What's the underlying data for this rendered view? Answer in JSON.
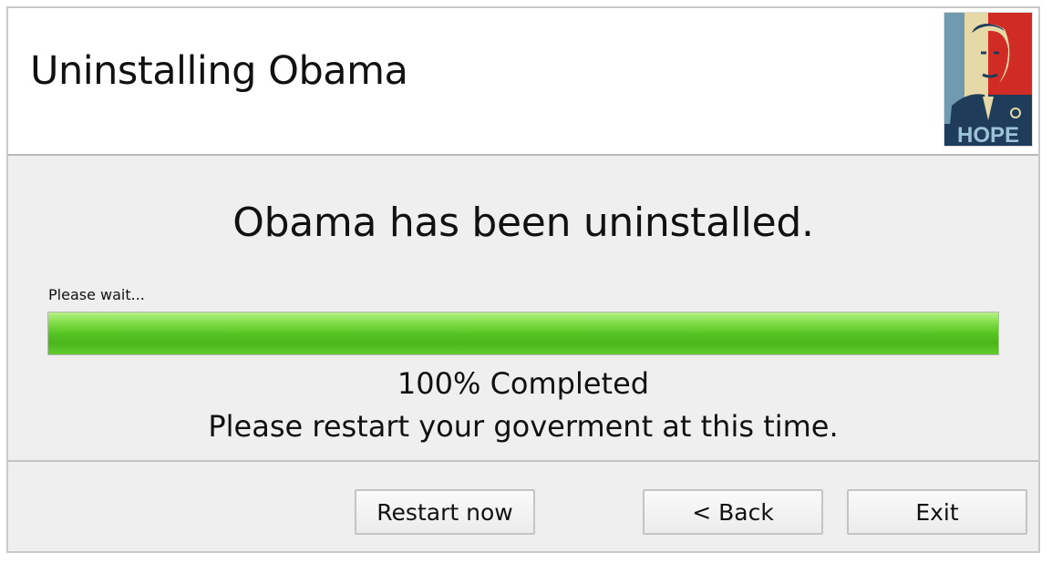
{
  "window": {
    "title": "Uninstalling Obama",
    "poster_text": "HOPE"
  },
  "main": {
    "headline": "Obama has been uninstalled.",
    "wait_label": "Please wait...",
    "progress_fraction": 1.0,
    "completed_text": "100% Completed",
    "restart_message": "Please restart your goverment at this time."
  },
  "buttons": {
    "restart": "Restart now",
    "back": "< Back",
    "exit": "Exit"
  },
  "colors": {
    "progress": "#56c323",
    "poster_red": "#d12b25",
    "poster_blue": "#1f3c5a",
    "poster_beige": "#e6d9a8"
  }
}
